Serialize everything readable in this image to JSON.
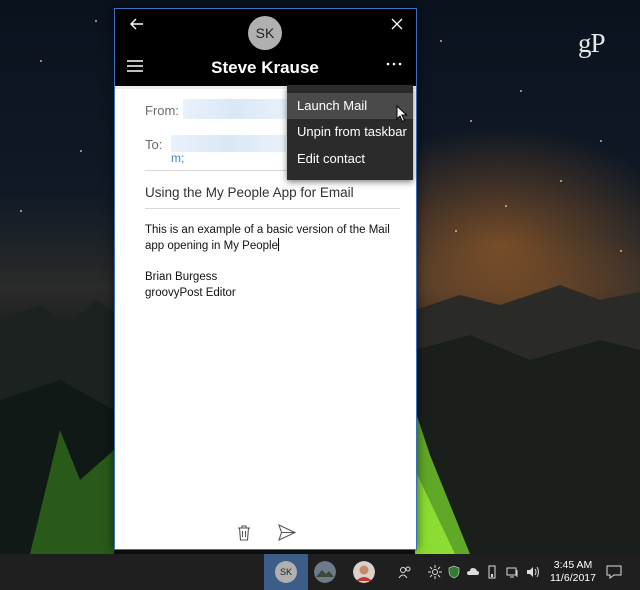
{
  "watermark": "gP",
  "people_window": {
    "avatar_initials": "SK",
    "contact_name": "Steve Krause"
  },
  "mail": {
    "from_label": "From:",
    "to_label": "To:",
    "to_tail": "m;",
    "subject": "Using the My People App for Email",
    "body": "This is an example of a basic version of the Mail app opening in My People",
    "signature_name": "Brian Burgess",
    "signature_title": "groovyPost Editor"
  },
  "context_menu": {
    "items": [
      "Launch Mail",
      "Unpin from taskbar",
      "Edit contact"
    ]
  },
  "taskbar": {
    "contact_initials": "SK",
    "time": "3:45 AM",
    "date": "11/6/2017"
  },
  "colors": {
    "window_accent": "#3b6fbf",
    "link_blue": "#3f84c7",
    "active_taskbar": "#3b5d88"
  }
}
